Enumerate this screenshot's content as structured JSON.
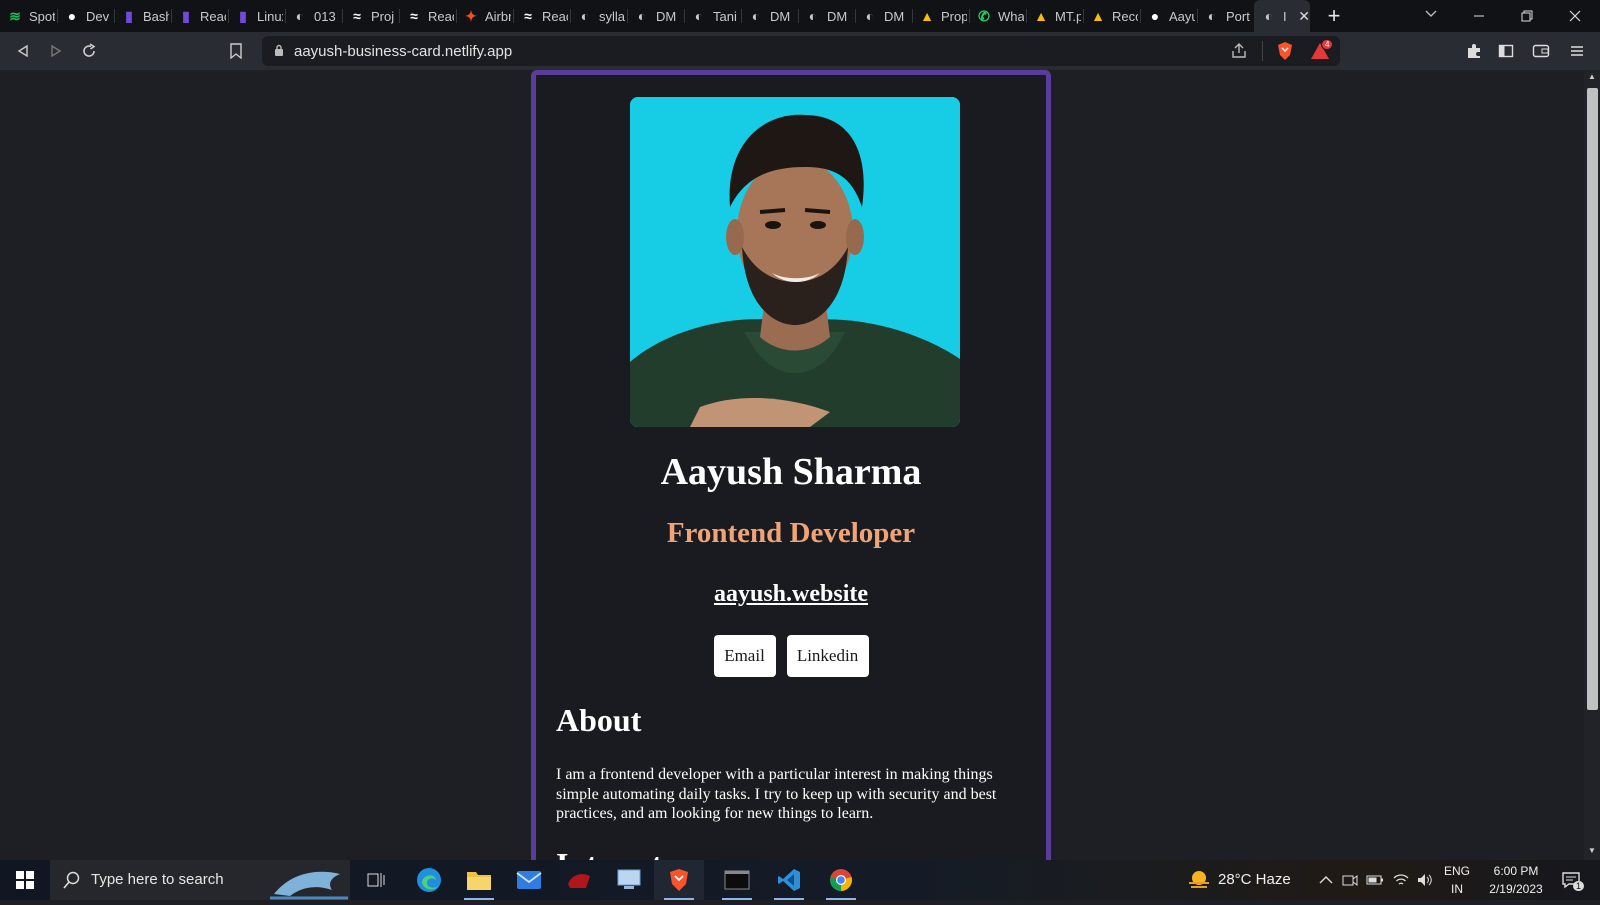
{
  "browser": {
    "tabs": [
      {
        "title": "Spotify",
        "icon": "spotify-icon",
        "color": "#1db954"
      },
      {
        "title": "Dev",
        "icon": "github-icon",
        "color": "#ffffff"
      },
      {
        "title": "Bash",
        "icon": "bookmark-tab-icon",
        "color": "#6f4bd8"
      },
      {
        "title": "React",
        "icon": "bookmark-tab-icon",
        "color": "#6f4bd8"
      },
      {
        "title": "Linux",
        "icon": "bookmark-tab-icon",
        "color": "#6f4bd8"
      },
      {
        "title": "013",
        "icon": "globe-icon",
        "color": "#c9cad0"
      },
      {
        "title": "Proj",
        "icon": "wave-icon",
        "color": "#ffffff"
      },
      {
        "title": "React",
        "icon": "wave-icon",
        "color": "#ffffff"
      },
      {
        "title": "Airbnb",
        "icon": "figma-icon",
        "color": "#f24e1e"
      },
      {
        "title": "React",
        "icon": "wave-icon",
        "color": "#ffffff"
      },
      {
        "title": "sylla",
        "icon": "globe-icon",
        "color": "#c9cad0"
      },
      {
        "title": "DM",
        "icon": "globe-icon",
        "color": "#c9cad0"
      },
      {
        "title": "Tani",
        "icon": "globe-icon",
        "color": "#c9cad0"
      },
      {
        "title": "DM",
        "icon": "globe-icon",
        "color": "#c9cad0"
      },
      {
        "title": "DM",
        "icon": "globe-icon",
        "color": "#c9cad0"
      },
      {
        "title": "DM",
        "icon": "globe-icon",
        "color": "#c9cad0"
      },
      {
        "title": "Prop",
        "icon": "drive-icon",
        "color": "#fbbc04"
      },
      {
        "title": "WhatsApp",
        "icon": "whatsapp-icon",
        "color": "#25d366"
      },
      {
        "title": "MT.p",
        "icon": "drive-icon",
        "color": "#fbbc04"
      },
      {
        "title": "Reco",
        "icon": "drive-icon",
        "color": "#fbbc04"
      },
      {
        "title": "Aayu",
        "icon": "github-icon",
        "color": "#ffffff"
      },
      {
        "title": "Port",
        "icon": "globe-icon",
        "color": "#c9cad0"
      }
    ],
    "active_tab": {
      "title": "I",
      "icon": "globe-icon"
    },
    "url": "aayush-business-card.netlify.app",
    "shield_badge": "4"
  },
  "card": {
    "photo_alt": "Aayush Sharma",
    "name": "Aayush Sharma",
    "role": "Frontend Developer",
    "website": "aayush.website",
    "buttons": {
      "email": "Email",
      "linkedin": "Linkedin"
    },
    "about_heading": "About",
    "about_text": "I am a frontend developer with a particular interest in making things simple automating daily tasks. I try to keep up with security and best practices, and am looking for new things to learn.",
    "interests_heading": "Interests"
  },
  "taskbar": {
    "search_placeholder": "Type here to search",
    "weather": "28°C  Haze",
    "lang_top": "ENG",
    "lang_bottom": "IN",
    "time": "6:00 PM",
    "date": "2/19/2023",
    "notification_count": "1"
  }
}
